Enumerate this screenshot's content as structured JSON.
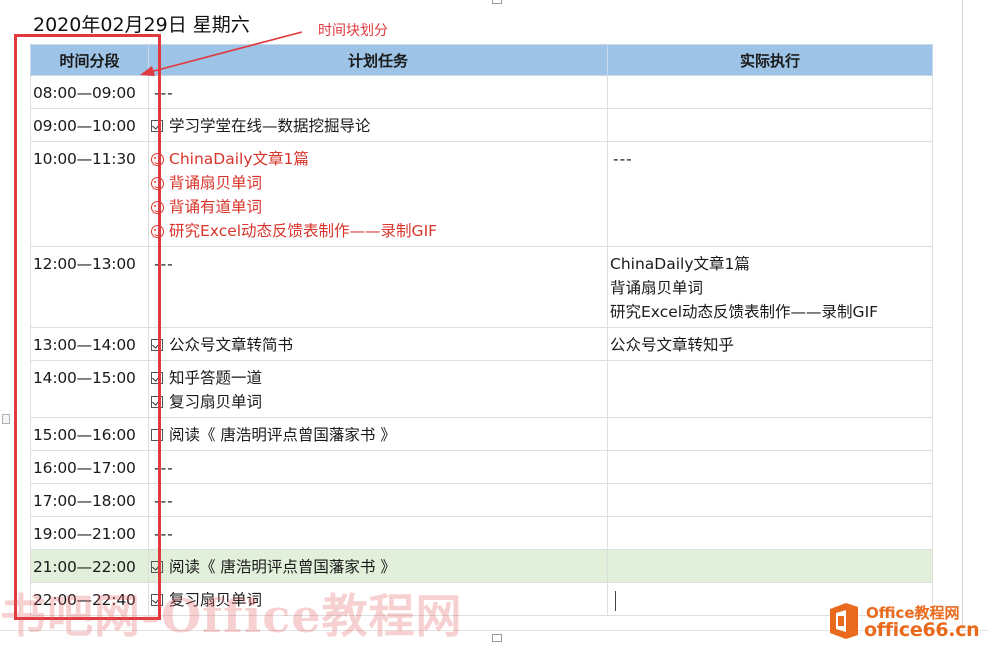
{
  "document": {
    "date_heading": "2020年02月29日 星期六"
  },
  "annotation": {
    "label": "时间块划分",
    "color": "#e0393e"
  },
  "table": {
    "headers": {
      "time": "时间分段",
      "plan": "计划任务",
      "actual": "实际执行"
    },
    "header_bg": "#9dc3e6",
    "highlight_bg": "#e2efda",
    "rows": [
      {
        "time": "08:00—09:00",
        "plan_dash": "---"
      },
      {
        "time": "09:00—10:00",
        "plan": [
          "学习学堂在线—数据挖掘导论"
        ]
      },
      {
        "time": "10:00—11:30",
        "plan": [
          "ChinaDaily文章1篇",
          "背诵扇贝单词",
          "背诵有道单词",
          "研究Excel动态反馈表制作——录制GIF"
        ],
        "actual_dash": "---"
      },
      {
        "time": "12:00—13:00",
        "plan_dash": "---",
        "actual": [
          "ChinaDaily文章1篇",
          "背诵扇贝单词",
          "研究Excel动态反馈表制作——录制GIF"
        ]
      },
      {
        "time": "13:00—14:00",
        "plan": [
          "公众号文章转简书"
        ],
        "actual": [
          "公众号文章转知乎"
        ]
      },
      {
        "time": "14:00—15:00",
        "plan": [
          "知乎答题一道",
          "复习扇贝单词"
        ]
      },
      {
        "time": "15:00—16:00",
        "plan": [
          "阅读《 唐浩明评点曾国藩家书 》"
        ]
      },
      {
        "time": "16:00—17:00",
        "plan_dash": "---"
      },
      {
        "time": "17:00—18:00",
        "plan_dash": "---"
      },
      {
        "time": "19:00—21:00",
        "plan_dash": "---"
      },
      {
        "time": "21:00—22:00",
        "plan": [
          "阅读《 唐浩明评点曾国藩家书 》"
        ]
      },
      {
        "time": "22:00—22:40",
        "plan": [
          "复习扇贝单词"
        ]
      }
    ]
  },
  "watermark": {
    "text": "书吧网-Office教程网"
  },
  "logo": {
    "line1": "Office教程网",
    "line2": "office66.cn",
    "color": "#e96a1c"
  }
}
